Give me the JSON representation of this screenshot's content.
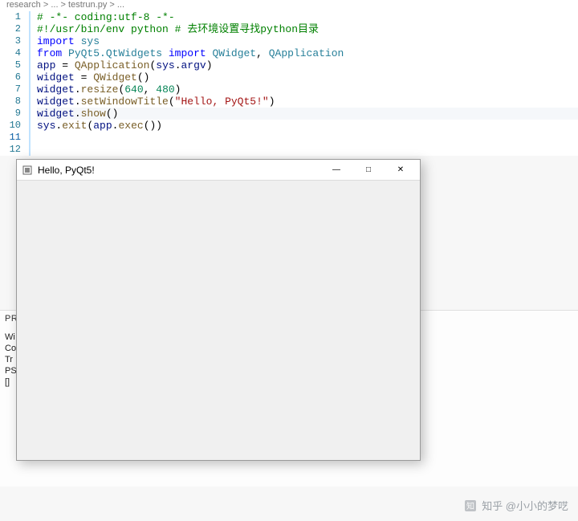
{
  "breadcrumb": "research > ... > testrun.py > ...",
  "code": {
    "lines": [
      {
        "n": 1,
        "tokens": [
          [
            "c-comment",
            "# -*- coding:utf-8 -*-"
          ]
        ]
      },
      {
        "n": 2,
        "tokens": [
          [
            "c-comment",
            "#!/usr/bin/env python # 去环境设置寻找python目录"
          ]
        ]
      },
      {
        "n": 3,
        "tokens": [
          [
            "",
            ""
          ]
        ]
      },
      {
        "n": 4,
        "tokens": [
          [
            "c-kw",
            "import"
          ],
          [
            "",
            " "
          ],
          [
            "c-mod",
            "sys"
          ]
        ]
      },
      {
        "n": 5,
        "tokens": [
          [
            "c-kw",
            "from"
          ],
          [
            "",
            " "
          ],
          [
            "c-mod",
            "PyQt5.QtWidgets"
          ],
          [
            "",
            " "
          ],
          [
            "c-kw",
            "import"
          ],
          [
            "",
            " "
          ],
          [
            "c-mod",
            "QWidget"
          ],
          [
            "c-op",
            ", "
          ],
          [
            "c-mod",
            "QApplication"
          ]
        ]
      },
      {
        "n": 6,
        "tokens": [
          [
            "",
            ""
          ]
        ]
      },
      {
        "n": 7,
        "tokens": [
          [
            "c-ident",
            "app"
          ],
          [
            "",
            " "
          ],
          [
            "c-op",
            "="
          ],
          [
            "",
            " "
          ],
          [
            "c-func",
            "QApplication"
          ],
          [
            "c-op",
            "("
          ],
          [
            "c-ident",
            "sys"
          ],
          [
            "c-op",
            "."
          ],
          [
            "c-ident",
            "argv"
          ],
          [
            "c-op",
            ")"
          ]
        ]
      },
      {
        "n": 8,
        "tokens": [
          [
            "c-ident",
            "widget"
          ],
          [
            "",
            " "
          ],
          [
            "c-op",
            "="
          ],
          [
            "",
            " "
          ],
          [
            "c-func",
            "QWidget"
          ],
          [
            "c-op",
            "()"
          ]
        ]
      },
      {
        "n": 9,
        "tokens": [
          [
            "c-ident",
            "widget"
          ],
          [
            "c-op",
            "."
          ],
          [
            "c-func",
            "resize"
          ],
          [
            "c-op",
            "("
          ],
          [
            "c-num",
            "640"
          ],
          [
            "c-op",
            ", "
          ],
          [
            "c-num",
            "480"
          ],
          [
            "c-op",
            ")"
          ]
        ]
      },
      {
        "n": 10,
        "tokens": [
          [
            "c-ident",
            "widget"
          ],
          [
            "c-op",
            "."
          ],
          [
            "c-func",
            "setWindowTitle"
          ],
          [
            "c-op",
            "("
          ],
          [
            "c-str",
            "\"Hello, PyQt5!\""
          ],
          [
            "c-op",
            ")"
          ]
        ]
      },
      {
        "n": 11,
        "tokens": [
          [
            "c-ident",
            "widget"
          ],
          [
            "c-op",
            "."
          ],
          [
            "c-func",
            "show"
          ],
          [
            "c-op",
            "()"
          ]
        ],
        "current": true
      },
      {
        "n": 12,
        "tokens": [
          [
            "c-ident",
            "sys"
          ],
          [
            "c-op",
            "."
          ],
          [
            "c-func",
            "exit"
          ],
          [
            "c-op",
            "("
          ],
          [
            "c-ident",
            "app"
          ],
          [
            "c-op",
            "."
          ],
          [
            "c-func",
            "exec"
          ],
          [
            "c-op",
            "())"
          ]
        ]
      }
    ]
  },
  "terminal": {
    "tab_label": "PR",
    "lines": [
      "Wi",
      "Co",
      "",
      "Tr",
      "",
      "PS",
      "[]"
    ]
  },
  "app_window": {
    "title": "Hello, PyQt5!",
    "icon": "window-icon",
    "min_glyph": "—",
    "max_glyph": "□",
    "close_glyph": "✕"
  },
  "watermark": {
    "text": "知乎 @小小的梦呓"
  }
}
